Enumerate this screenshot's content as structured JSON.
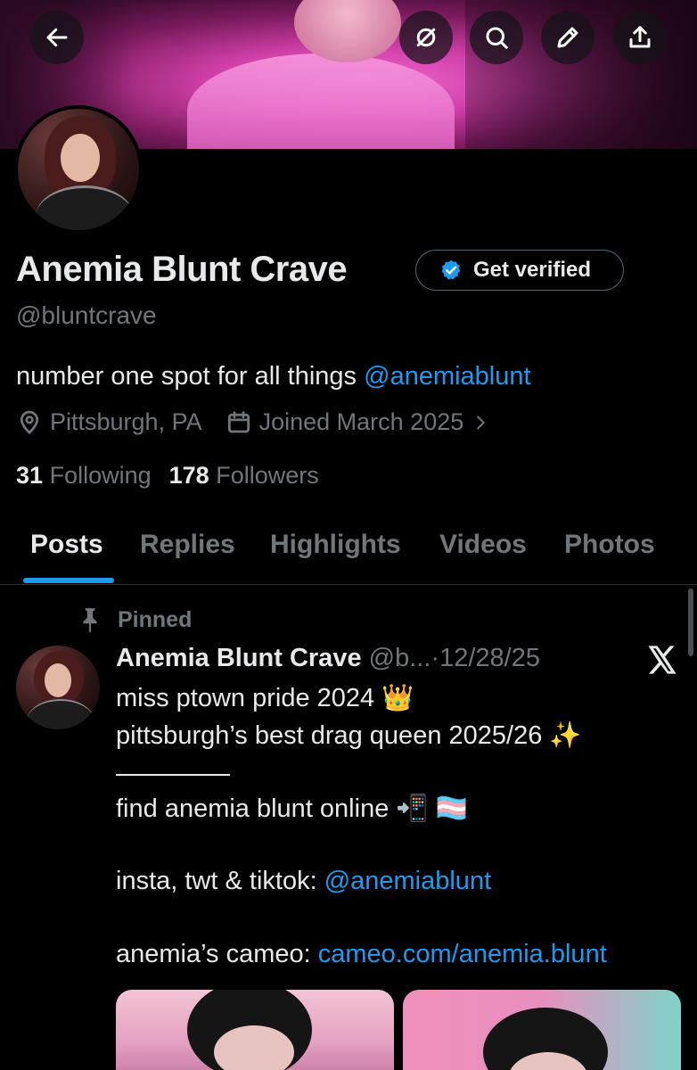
{
  "header": {
    "back_icon": "arrow-left-icon",
    "actions": [
      "hide-icon",
      "search-icon",
      "edit-icon",
      "share-icon"
    ]
  },
  "profile": {
    "name": "Anemia Blunt Crave",
    "get_verified_label": "Get verified",
    "handle": "@bluntcrave",
    "bio_prefix": "number one spot for all things ",
    "bio_mention": "@anemiablunt",
    "location": "Pittsburgh, PA",
    "joined": "Joined March 2025",
    "following_count": "31",
    "following_label": "Following",
    "followers_count": "178",
    "followers_label": "Followers"
  },
  "tabs": [
    "Posts",
    "Replies",
    "Highlights",
    "Videos",
    "Photos"
  ],
  "active_tab": "Posts",
  "post": {
    "pinned_label": "Pinned",
    "author_name": "Anemia Blunt Crave",
    "author_handle": "@b...",
    "separator": "·",
    "date": "12/28/25",
    "line1": "miss ptown pride 2024 👑",
    "line2": "pittsburgh’s best drag queen 2025/26 ✨",
    "line3": "find anemia blunt online 📲 🏳️‍⚧️",
    "line4_prefix": "insta, twt & tiktok: ",
    "line4_mention": "@anemiablunt",
    "line5_prefix": "anemia’s cameo: ",
    "line5_link": "cameo.com/anemia.blunt"
  },
  "colors": {
    "accent": "#1d9bf0",
    "muted": "#71767b",
    "text": "#e7e9ea",
    "background": "#000000"
  }
}
